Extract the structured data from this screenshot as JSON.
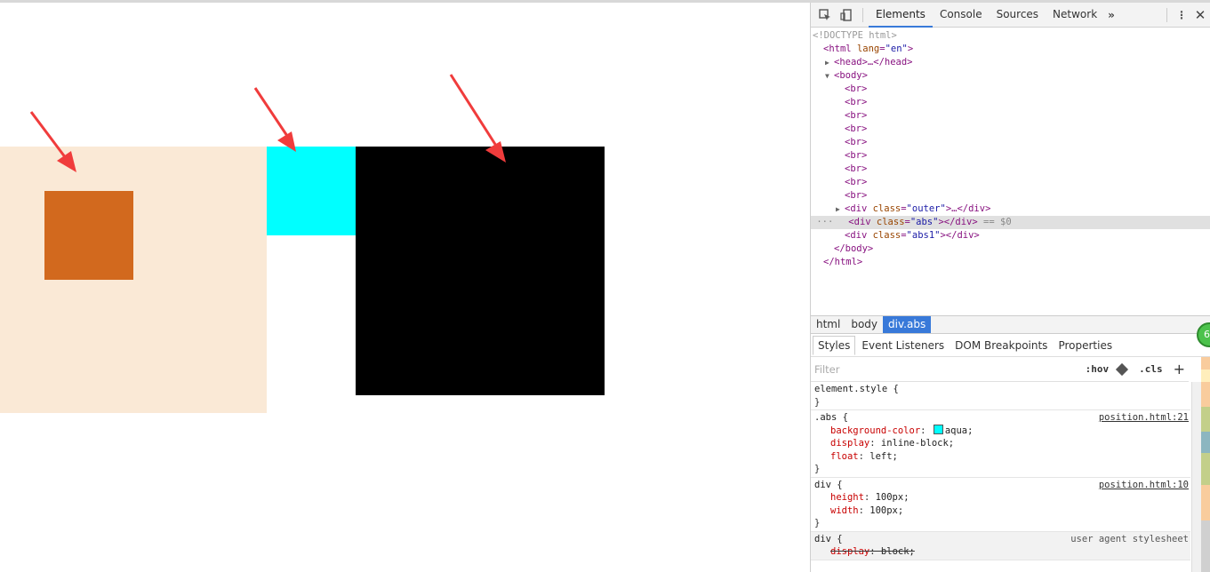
{
  "devtools": {
    "tabs": [
      "Elements",
      "Console",
      "Sources",
      "Network"
    ],
    "more_label": "»",
    "close_label": "✕",
    "dom": {
      "doctype": "<!DOCTYPE html>",
      "html_open_tag": "html",
      "html_lang_attr": "lang",
      "html_lang_val": "\"en\"",
      "head_line": "<head>…</head>",
      "body_open": "<body>",
      "br": "<br>",
      "outer_attr": "class",
      "outer_val": "\"outer\"",
      "abs_val": "\"abs\"",
      "abs1_val": "\"abs1\"",
      "selected_suffix": " == $0",
      "body_close": "</body>",
      "html_close": "</html>"
    },
    "breadcrumbs": [
      "html",
      "body",
      "div.abs"
    ],
    "style_tabs": [
      "Styles",
      "Event Listeners",
      "DOM Breakpoints",
      "Properties"
    ],
    "filter_placeholder": "Filter",
    "hov_label": ":hov",
    "cls_label": ".cls",
    "plus_label": "+",
    "badge_text": "6",
    "rules": {
      "element_style": "element.style {",
      "close_brace": "}",
      "abs_selector": ".abs {",
      "abs_source": "position.html:21",
      "abs_decls": [
        {
          "prop": "background-color",
          "value": "aqua;"
        },
        {
          "prop": "display",
          "value": "inline-block;"
        },
        {
          "prop": "float",
          "value": "left;"
        }
      ],
      "div_selector": "div {",
      "div_source": "position.html:10",
      "div_decls": [
        {
          "prop": "height",
          "value": "100px;"
        },
        {
          "prop": "width",
          "value": "100px;"
        }
      ],
      "ua_selector": "div {",
      "ua_source": "user agent stylesheet",
      "ua_decls": [
        {
          "prop": "display",
          "value": "block;"
        }
      ]
    }
  },
  "colors": {
    "outer_bg": "#fae9d6",
    "inner_box": "#d2691e",
    "abs_box": "#00ffff",
    "abs1_box": "#000000",
    "arrow": "#f03c3c",
    "devtools_accent": "#3879d9"
  }
}
